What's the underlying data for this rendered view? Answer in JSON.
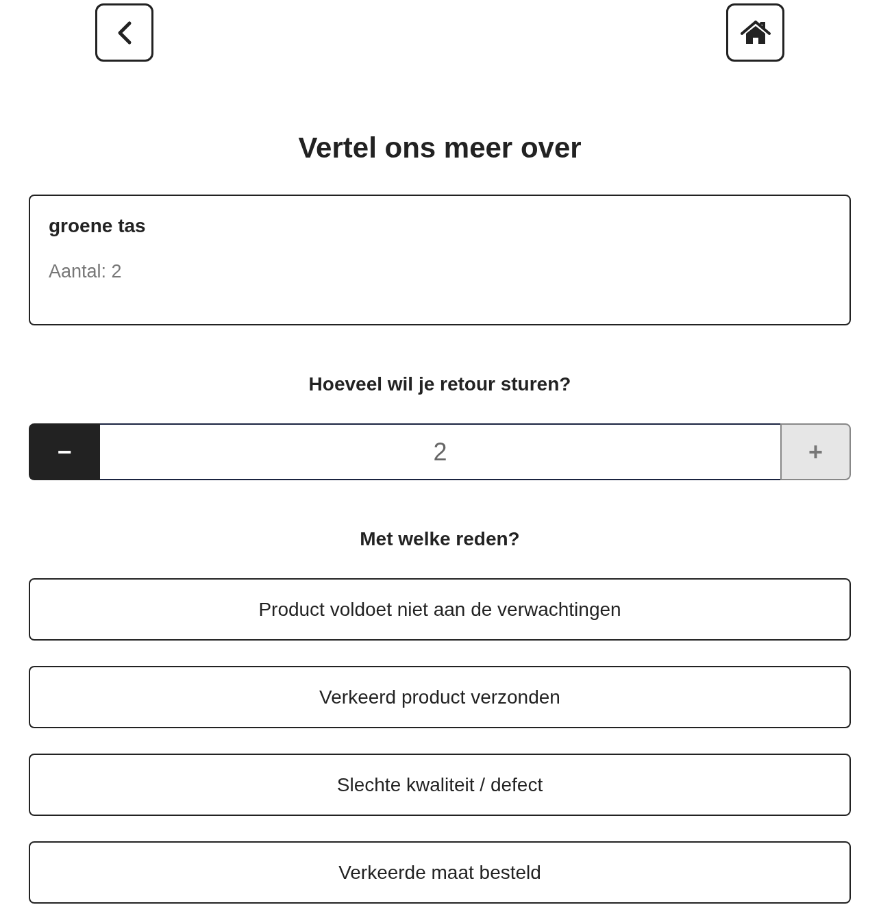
{
  "title": "Vertel ons meer over",
  "product": {
    "name": "groene tas",
    "quantity": "Aantal: 2"
  },
  "quantity_question": "Hoeveel wil je retour sturen?",
  "stepper": {
    "minus": {
      "label": "−",
      "disabled": false
    },
    "value": "2",
    "plus": {
      "label": "+",
      "disabled": true
    }
  },
  "reason_question": "Met welke reden?",
  "reasons": [
    {
      "label": "Product voldoet niet aan de verwachtingen",
      "selected": false
    },
    {
      "label": "Verkeerd product verzonden",
      "selected": false
    },
    {
      "label": "Slechte kwaliteit / defect",
      "selected": false
    },
    {
      "label": "Verkeerde maat besteld",
      "selected": false
    }
  ]
}
